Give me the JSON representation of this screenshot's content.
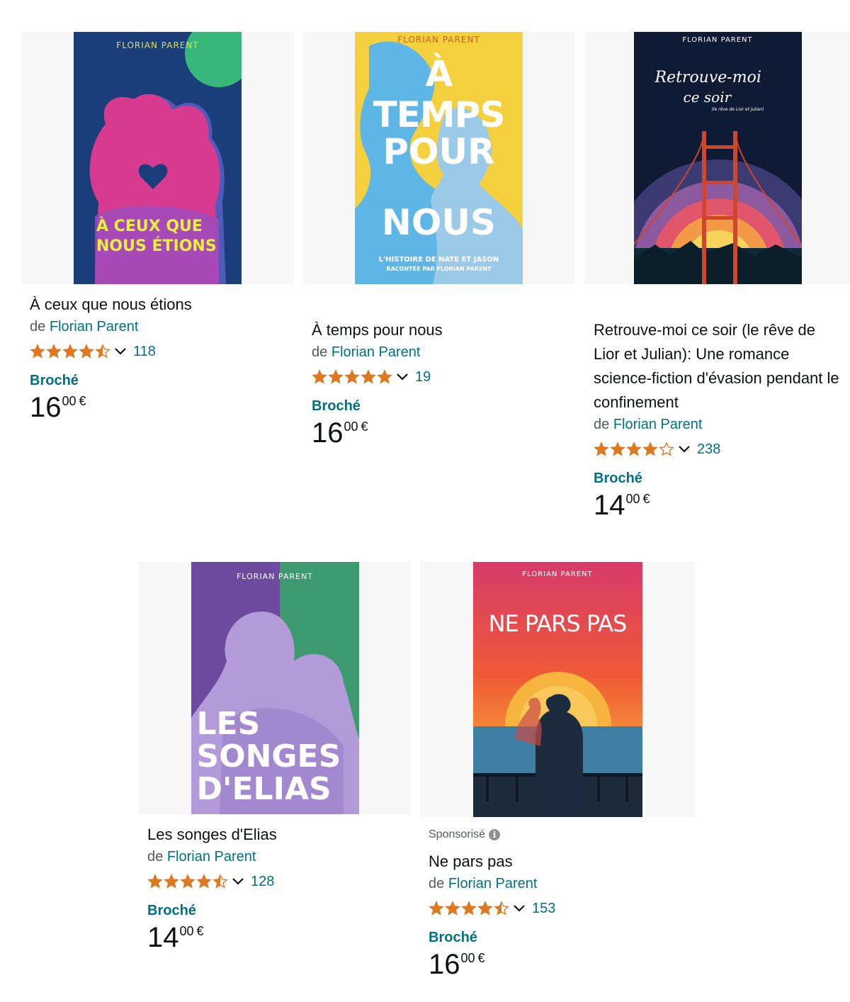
{
  "colors": {
    "link": "#007185",
    "star": "#de7921",
    "text": "#0f1111",
    "muted": "#565959"
  },
  "products": [
    {
      "title": "À ceux que nous étions",
      "author_prefix": "de",
      "author": "Florian Parent",
      "rating": 4.5,
      "rating_count": "118",
      "format": "Broché",
      "price_whole": "16",
      "price_fraction": "00",
      "currency": "€",
      "cover": {
        "author_mark": "FLORIAN PARENT",
        "line1": "À CEUX QUE",
        "line2": "NOUS ÉTIONS"
      }
    },
    {
      "title": "À temps pour nous",
      "author_prefix": "de",
      "author": "Florian Parent",
      "rating": 5,
      "rating_count": "19",
      "format": "Broché",
      "price_whole": "16",
      "price_fraction": "00",
      "currency": "€",
      "cover": {
        "author_mark": "FLORIAN PARENT",
        "line1": "À TEMPS",
        "line2": "POUR",
        "line3": "NOUS",
        "tagline1": "L'HISTOIRE DE NATE ET JASON",
        "tagline2": "RACONTÉE PAR FLORIAN PARENT"
      }
    },
    {
      "title": "Retrouve-moi ce soir (le rêve de Lior et Julian): Une romance science-fiction d'évasion pendant le confinement",
      "author_prefix": "de",
      "author": "Florian Parent",
      "rating": 4,
      "rating_count": "238",
      "format": "Broché",
      "price_whole": "14",
      "price_fraction": "00",
      "currency": "€",
      "cover": {
        "author_mark": "FLORIAN PARENT",
        "line1": "Retrouve-moi",
        "line2": "ce soir",
        "line3": "(le rêve de Lior et Julian)"
      }
    },
    {
      "title": "Les songes d'Elias",
      "author_prefix": "de",
      "author": "Florian Parent",
      "rating": 4.5,
      "rating_count": "128",
      "format": "Broché",
      "price_whole": "14",
      "price_fraction": "00",
      "currency": "€",
      "cover": {
        "author_mark": "FLORIAN PARENT",
        "line1": "LES",
        "line2": "SONGES",
        "line3": "D'ELIAS"
      }
    },
    {
      "sponsored": "Sponsorisé",
      "title": "Ne pars pas",
      "author_prefix": "de",
      "author": "Florian Parent",
      "rating": 4.5,
      "rating_count": "153",
      "format": "Broché",
      "price_whole": "16",
      "price_fraction": "00",
      "currency": "€",
      "cover": {
        "author_mark": "FLORIAN PARENT",
        "line1": "NE PARS PAS"
      }
    }
  ]
}
